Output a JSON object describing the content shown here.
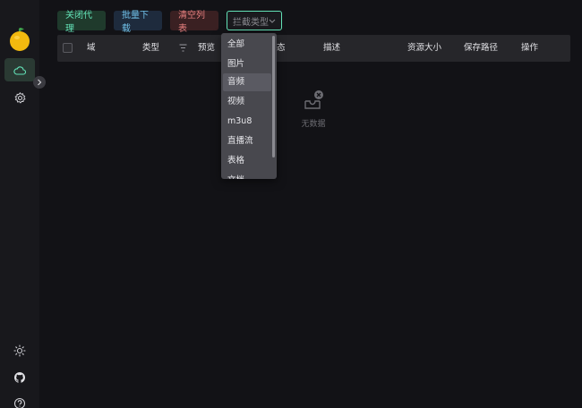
{
  "toolbar": {
    "close_proxy": "关闭代理",
    "batch_download": "批量下载",
    "clear_list": "清空列表",
    "intercept_type": "拦截类型"
  },
  "table": {
    "columns": [
      "域",
      "类型",
      "预览",
      "态",
      "描述",
      "资源大小",
      "保存路径",
      "操作"
    ]
  },
  "empty": {
    "text": "无数据"
  },
  "dropdown": {
    "options": [
      "全部",
      "图片",
      "音频",
      "视频",
      "m3u8",
      "直播流",
      "表格",
      "文档"
    ],
    "hovered": "音频"
  },
  "colors": {
    "accent": "#63e2b7",
    "info": "#70c0e8",
    "error": "#e88080",
    "background": "#121216"
  },
  "icons": {
    "sidebar": [
      "cloud-icon",
      "gear-icon"
    ],
    "bottom": [
      "sun-icon",
      "github-icon",
      "help-icon"
    ]
  }
}
